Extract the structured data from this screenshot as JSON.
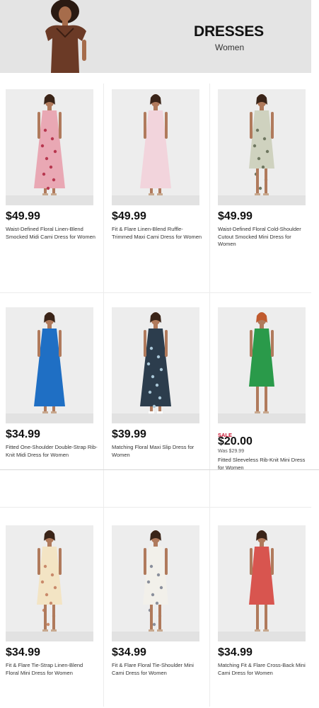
{
  "banner": {
    "title": "DRESSES",
    "subtitle": "Women"
  },
  "products": [
    {
      "price": "$49.99",
      "name": "Waist-Defined Floral Linen-Blend Smocked Midi Cami Dress for Women",
      "dress_color": "#e9a8b4",
      "pattern": "floral-pink"
    },
    {
      "price": "$49.99",
      "name": "Fit & Flare Linen-Blend Ruffle-Trimmed Maxi Cami Dress for Women",
      "dress_color": "#f2d4dc",
      "pattern": "solid"
    },
    {
      "price": "$49.99",
      "name": "Waist-Defined Floral Cold-Shoulder Cutout Smocked Mini Dress for Women",
      "dress_color": "#cfd2bf",
      "pattern": "floral-sage"
    },
    {
      "price": "$34.99",
      "name": "Fitted One-Shoulder Double-Strap Rib-Knit Midi Dress for Women",
      "dress_color": "#1f6fc4",
      "pattern": "solid"
    },
    {
      "price": "$39.99",
      "name": "Matching Floral Maxi Slip Dress for Women",
      "dress_color": "#2c3d4d",
      "pattern": "floral-dark"
    },
    {
      "price": "$20.00",
      "sale": "SALE",
      "was": "Was $29.99",
      "name": "Fitted Sleeveless Rib-Knit Mini Dress for Women",
      "dress_color": "#2a9a4a",
      "pattern": "solid"
    },
    {
      "price": "$34.99",
      "name": "Fit & Flare Tie-Strap Linen-Blend Floral Mini Dress for Women",
      "dress_color": "#f3e4c4",
      "pattern": "floral-cream"
    },
    {
      "price": "$34.99",
      "name": "Fit & Flare Floral Tie-Shoulder Mini Cami Dress for Women",
      "dress_color": "#f2f0ea",
      "pattern": "floral-white"
    },
    {
      "price": "$34.99",
      "name": "Matching Fit & Flare Cross-Back Mini Cami Dress for Women",
      "dress_color": "#d8554f",
      "pattern": "solid"
    }
  ],
  "icons": {
    "banner_model": "model-photo",
    "product_photo": "product-photo"
  }
}
